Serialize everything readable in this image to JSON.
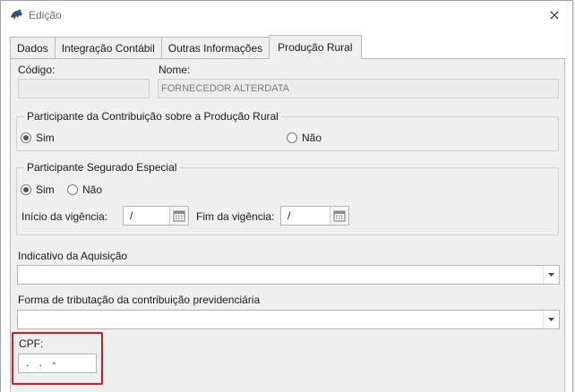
{
  "window": {
    "title": "Edição",
    "close_glyph": "✕",
    "icon": "app-logo-icon"
  },
  "tabs": [
    {
      "label": "Dados"
    },
    {
      "label": "Integração Contábil"
    },
    {
      "label": "Outras Informações"
    },
    {
      "label": "Produção Rural",
      "active": true
    }
  ],
  "codigo": {
    "label": "Código:",
    "value": ""
  },
  "nome": {
    "label": "Nome:",
    "value": "FORNECEDOR ALTERDATA"
  },
  "contribuicao_group": {
    "title": "Participante da Contribuição sobre a Produção Rural",
    "option_yes": "Sim",
    "option_no": "Não",
    "selected": "Sim"
  },
  "segurado_group": {
    "title": "Participante Segurado Especial",
    "option_yes": "Sim",
    "option_no": "Não",
    "selected": "Sim",
    "inicio_label": "Início da vigência:",
    "inicio_value": "/",
    "fim_label": "Fim da vigência:",
    "fim_value": "/"
  },
  "indicativo": {
    "label": "Indicativo da Aquisição",
    "value": ""
  },
  "forma_tributacao": {
    "label": "Forma de tributação da contribuição previdenciária",
    "value": ""
  },
  "cpf": {
    "label": "CPF:",
    "mask": ". . -"
  },
  "colors": {
    "highlight": "#e0161b",
    "panel_bg": "#f0f0f0",
    "border": "#b9b9b9"
  }
}
